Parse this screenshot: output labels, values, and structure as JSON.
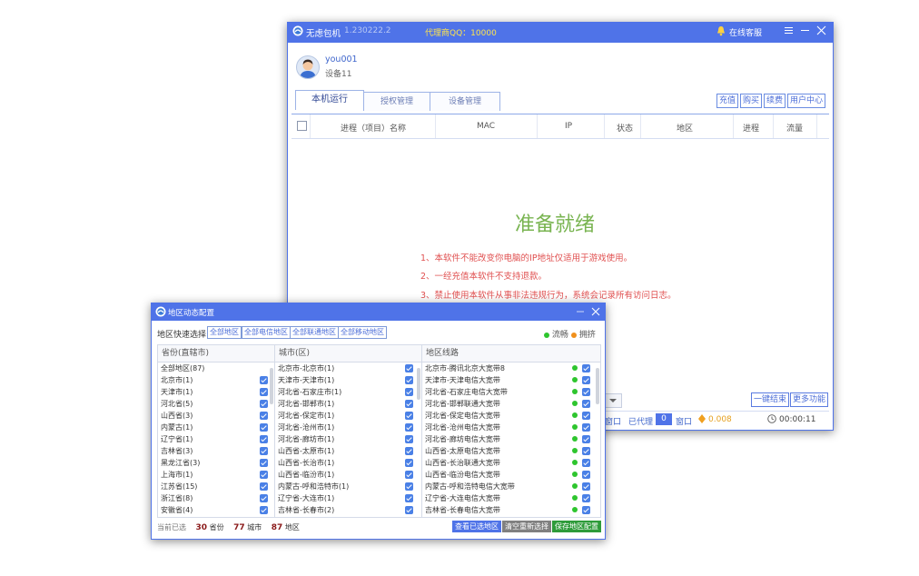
{
  "main": {
    "app_name": "无虑包机",
    "version": "1.230222.2",
    "agent_qq": "代理商QQ：10000",
    "online_service": "在线客服",
    "user_name": "you001",
    "device": "设备11",
    "tabs": [
      "本机运行",
      "授权管理",
      "设备管理"
    ],
    "right_buttons": [
      "充值",
      "购买",
      "续费",
      "用户中心"
    ],
    "columns": [
      "进程（项目）名称",
      "MAC",
      "IP",
      "状态",
      "地区",
      "进程",
      "流量"
    ],
    "ready_title": "准备就绪",
    "notices": [
      "1、本软件不能改变你电脑的IP地址仅适用于游戏使用。",
      "2、一经充值本软件不支持退款。",
      "3、禁止使用本软件从事非法违规行为，系统会记录所有访问日志。"
    ],
    "action_buttons": [
      "一键结束",
      "更多功能"
    ],
    "status": {
      "window_label": "窗口",
      "proxied_label": "已代理",
      "proxied_count": "0",
      "window_label_2": "窗口",
      "balance": "0.008",
      "timer": "00:00:11"
    },
    "colors": {
      "title_bar": "#4f73e8",
      "ready": "#79b451",
      "notice": "#e05050"
    }
  },
  "region": {
    "title": "地区动态配置",
    "quick_select_label": "地区快速选择:",
    "quick_buttons": [
      "全部地区",
      "全部电信地区",
      "全部联通地区",
      "全部移动地区"
    ],
    "legend": [
      "流畅",
      "拥挤"
    ],
    "panel_headers": [
      "省份(直辖市)",
      "城市(区)",
      "地区线路"
    ],
    "provinces": [
      "全部地区(87)",
      "北京市(1)",
      "天津市(1)",
      "河北省(5)",
      "山西省(3)",
      "内蒙古(1)",
      "辽宁省(1)",
      "吉林省(3)",
      "黑龙江省(3)",
      "上海市(1)",
      "江苏省(15)",
      "浙江省(8)",
      "安徽省(4)"
    ],
    "cities": [
      "北京市-北京市(1)",
      "天津市-天津市(1)",
      "河北省-石家庄市(1)",
      "河北省-邯郸市(1)",
      "河北省-保定市(1)",
      "河北省-沧州市(1)",
      "河北省-廊坊市(1)",
      "山西省-太原市(1)",
      "山西省-长治市(1)",
      "山西省-临汾市(1)",
      "内蒙古-呼和浩特市(1)",
      "辽宁省-大连市(1)",
      "吉林省-长春市(2)"
    ],
    "lines": [
      "北京市-腾讯北京大宽带8",
      "天津市-天津电信大宽带",
      "河北省-石家庄电信大宽带",
      "河北省-邯郸联通大宽带",
      "河北省-保定电信大宽带",
      "河北省-沧州电信大宽带",
      "河北省-廊坊电信大宽带",
      "山西省-太原电信大宽带",
      "山西省-长治联通大宽带",
      "山西省-临汾电信大宽带",
      "内蒙古-呼和浩特电信大宽带",
      "辽宁省-大连电信大宽带",
      "吉林省-长春电信大宽带"
    ],
    "footer": {
      "selected_label": "当前已选",
      "province_count": "30",
      "province_unit": "省份",
      "city_count": "77",
      "city_unit": "城市",
      "region_count": "87",
      "region_unit": "地区"
    },
    "footer_buttons": [
      "查看已选地区",
      "清空重新选择",
      "保存地区配置"
    ]
  }
}
